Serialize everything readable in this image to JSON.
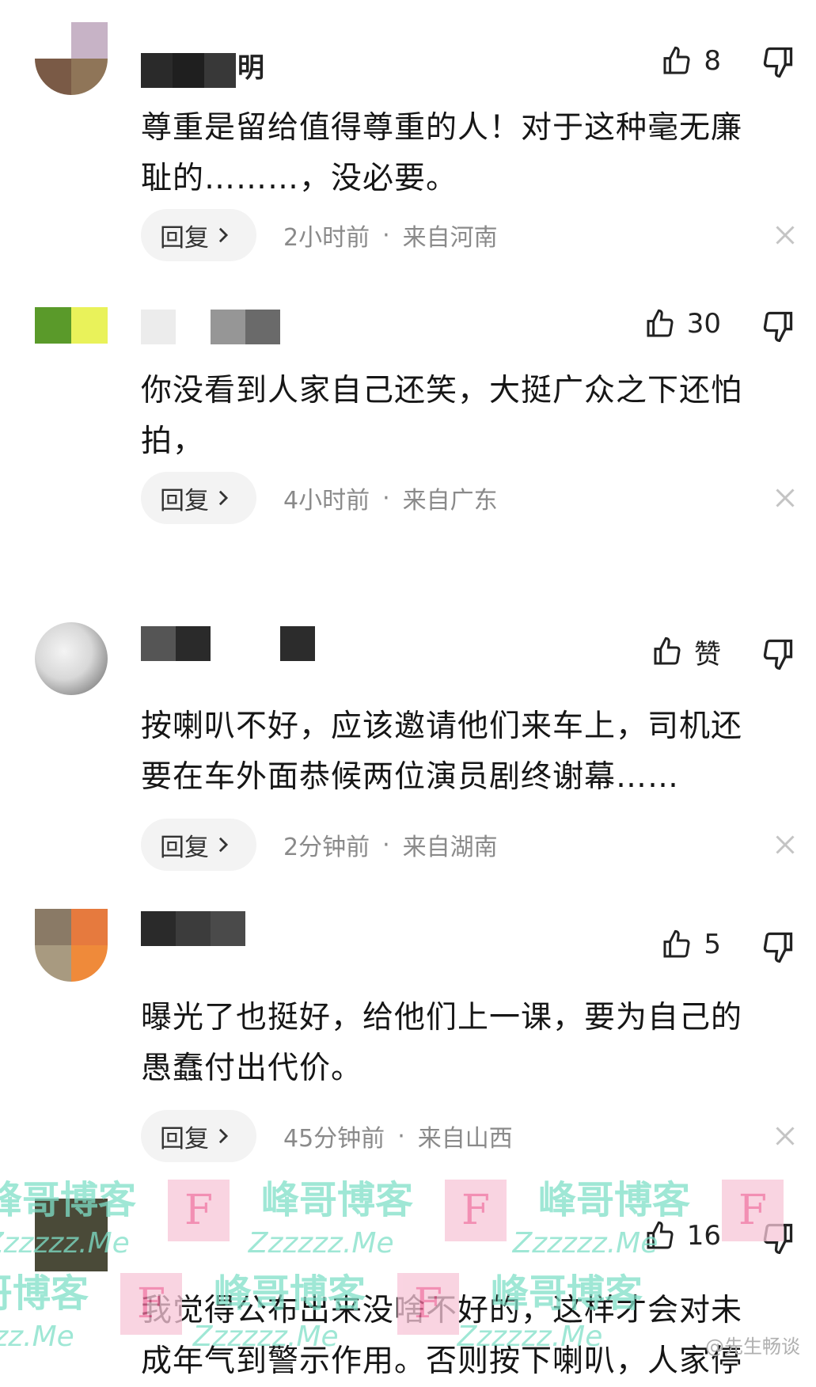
{
  "comments": [
    {
      "name_fragment": "明",
      "likes": "8",
      "text_line1": "尊重是留给值得尊重的人！对于这种毫无廉",
      "text_line2": "耻的………，没必要。",
      "reply_label": "回复",
      "time": "2小时前",
      "location": "来自河南"
    },
    {
      "likes": "30",
      "text_line1": "你没看到人家自己还笑，大挺广众之下还怕",
      "text_line2": "拍，",
      "reply_label": "回复",
      "time": "4小时前",
      "location": "来自广东"
    },
    {
      "likes": "赞",
      "text_line1": "按喇叭不好，应该邀请他们来车上，司机还",
      "text_line2": "要在车外面恭候两位演员剧终谢幕……",
      "reply_label": "回复",
      "time": "2分钟前",
      "location": "来自湖南"
    },
    {
      "likes": "5",
      "text_line1": "曝光了也挺好，给他们上一课，要为自己的",
      "text_line2": "愚蠢付出代价。",
      "reply_label": "回复",
      "time": "45分钟前",
      "location": "来自山西"
    },
    {
      "likes": "16",
      "text_line1": "我觉得公布出来没啥不好的，这样才会对未",
      "text_line2": "成年气到警示作用。否则按下喇叭，人家停"
    }
  ],
  "watermark": {
    "letter": "F",
    "title": "峰哥博客",
    "url": "Zzzzzz.Me"
  },
  "credit": "@先生畅谈",
  "colors": {
    "reply_bg": "#f3f3f3",
    "meta_text": "#8a8a8a",
    "watermark_pink": "#f8c6d8",
    "watermark_teal": "#7fe0c8"
  }
}
